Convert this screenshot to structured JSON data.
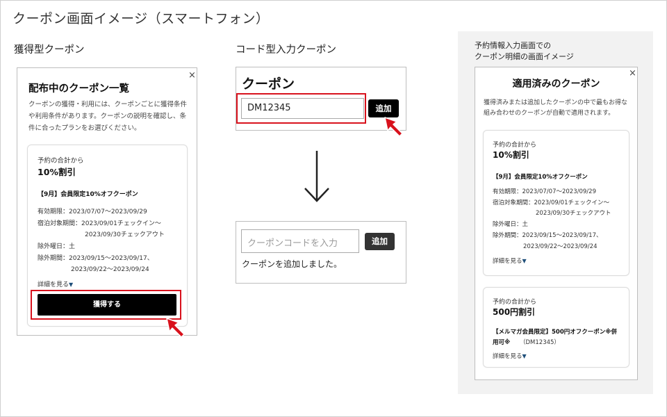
{
  "page_title": "クーポン画面イメージ（スマートフォン）",
  "sections": {
    "acquire": "獲得型クーポン",
    "code": "コード型入力クーポン",
    "applied_caption_line1": "予約情報入力画面での",
    "applied_caption_line2": "クーポン明細の画面イメージ"
  },
  "acquire_panel": {
    "close": "×",
    "heading": "配布中のクーポン一覧",
    "description": "クーポンの獲得・利用には、クーポンごとに獲得条件や利用条件があります。クーポンの説明を確認し、条件に合ったプランをお選びください。",
    "coupon": {
      "condition": "予約の合計から",
      "discount": "10%割引",
      "name": "【9月】会員限定10%オフクーポン",
      "validity": "有効期限：2023/07/07〜2023/09/29",
      "stay_period_1": "宿泊対象期間：2023/09/01チェックイン〜",
      "stay_period_2": "2023/09/30チェックアウト",
      "excluded_days": "除外曜日：土",
      "excluded_period_1": "除外期間：2023/09/15〜2023/09/17、",
      "excluded_period_2": "2023/09/22〜2023/09/24",
      "details_link": "詳細を見る",
      "details_arrow": "▼",
      "acquire_button": "獲得する"
    }
  },
  "code_panel": {
    "heading": "クーポン",
    "input_value": "DM12345",
    "add_button": "追加",
    "result_placeholder": "クーポンコードを入力",
    "result_add_button": "追加",
    "result_message": "クーポンを追加しました。"
  },
  "applied_panel": {
    "close": "×",
    "heading": "適用済みのクーポン",
    "description": "獲得済みまたは追加したクーポンの中で最もお得な組み合わせのクーポンが自動で適用されます。",
    "coupon1": {
      "condition": "予約の合計から",
      "discount": "10%割引",
      "name": "【9月】会員限定10%オフクーポン",
      "validity": "有効期限：2023/07/07〜2023/09/29",
      "stay_period_1": "宿泊対象期間：2023/09/01チェックイン〜",
      "stay_period_2": "2023/09/30チェックアウト",
      "excluded_days": "除外曜日：土",
      "excluded_period_1": "除外期間：2023/09/15〜2023/09/17、",
      "excluded_period_2": "2023/09/22〜2023/09/24",
      "details_link": "詳細を見る",
      "details_arrow": "▼"
    },
    "coupon2": {
      "condition": "予約の合計から",
      "discount": "500円割引",
      "name_line1": "【メルマガ会員限定】500円オフクーポン※併",
      "name_line2": "用可※",
      "code": "（DM12345）",
      "details_link": "詳細を見る",
      "details_arrow": "▼"
    }
  },
  "colors": {
    "highlight_red": "#d8121d",
    "button_black": "#000000",
    "link_arrow_blue": "#1f4f7a",
    "panel_gray": "#f2f2f2"
  },
  "icons": [
    "close-icon",
    "cursor-arrow-icon",
    "down-arrow-icon",
    "chevron-down-icon"
  ]
}
